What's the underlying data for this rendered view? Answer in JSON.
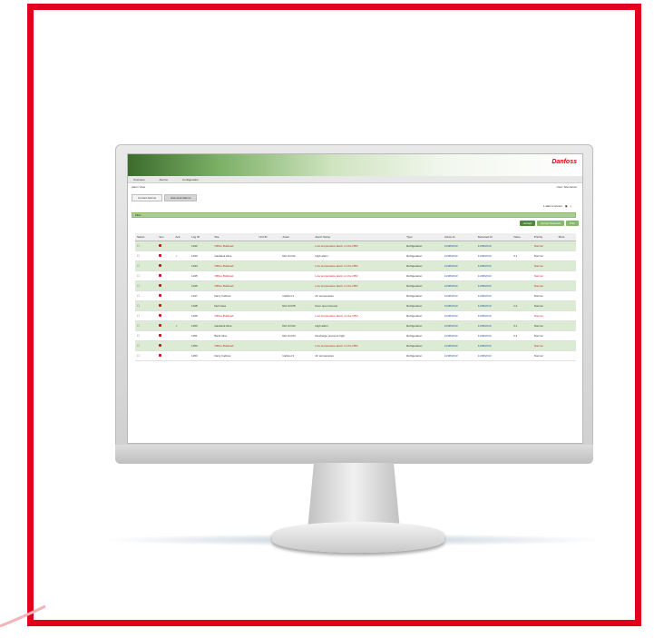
{
  "brand": {
    "name": "Danfoss"
  },
  "colors": {
    "accent": "#e2001a",
    "header_green": "#7bb065",
    "row_alt": "#dcebd3"
  },
  "app": {
    "menu": [
      "Overview",
      "Alarms",
      "Configuration"
    ],
    "breadcrumb": "Alarm View",
    "user_info": "User: Site Admin",
    "tabs": [
      "Current Alarms",
      "Historical Alarms"
    ],
    "view_label": "1 alarms shown",
    "filter_bar": "Filter",
    "actions": [
      "Accept",
      "Accept Selected",
      "Print"
    ],
    "columns": [
      "Select",
      "Sev",
      "Ack",
      "Log ID",
      "Site",
      "Unit ID",
      "Asset",
      "Alarm Name",
      "Type",
      "Active At",
      "Received At",
      "Value",
      "Priority",
      "More"
    ],
    "rows": [
      {
        "log": "1242",
        "site": "Offline Bulkload",
        "unit": "",
        "asset": "",
        "name": "Low temperature alarm on the OBV",
        "type": "Refrigeration",
        "active": "11/08/2013",
        "recv": "11/08/2013",
        "value": "",
        "priority": "Normal",
        "style": "red-alt",
        "ack": ""
      },
      {
        "log": "1243",
        "site": "Gasbank Alive",
        "unit": "",
        "asset": "Ref.Ctrl.02",
        "name": "High alarm",
        "type": "Refrigeration",
        "active": "11/08/2013",
        "recv": "11/08/2013",
        "value": "3.1",
        "priority": "Normal",
        "style": "",
        "ack": "✓"
      },
      {
        "log": "1244",
        "site": "Offline Bulkload",
        "unit": "",
        "asset": "",
        "name": "Low temperature alarm on the OBV",
        "type": "Refrigeration",
        "active": "11/08/2013",
        "recv": "11/08/2013",
        "value": "",
        "priority": "Normal",
        "style": "red-alt",
        "ack": ""
      },
      {
        "log": "1245",
        "site": "Offline Bulkload",
        "unit": "",
        "asset": "",
        "name": "Low temperature alarm on the OBV",
        "type": "Refrigeration",
        "active": "11/08/2013",
        "recv": "11/08/2013",
        "value": "",
        "priority": "Normal",
        "style": "red",
        "ack": ""
      },
      {
        "log": "1246",
        "site": "Offline Bulkload",
        "unit": "",
        "asset": "",
        "name": "Low temperature alarm on the OBV",
        "type": "Refrigeration",
        "active": "11/08/2013",
        "recv": "11/08/2013",
        "value": "",
        "priority": "Normal",
        "style": "red-alt",
        "ack": ""
      },
      {
        "log": "1247",
        "site": "Dairy Cabinet",
        "unit": "",
        "asset": "Cabinet 3",
        "name": "Air temperature",
        "type": "Refrigeration",
        "active": "11/08/2013",
        "recv": "11/08/2013",
        "value": "",
        "priority": "Normal",
        "style": "",
        "ack": ""
      },
      {
        "log": "1248",
        "site": "Deli Case",
        "unit": "",
        "asset": "Ref.Ctrl.05",
        "name": "Door open timeout",
        "type": "Refrigeration",
        "active": "11/08/2013",
        "recv": "11/08/2013",
        "value": "1.2",
        "priority": "Normal",
        "style": "alt",
        "ack": ""
      },
      {
        "log": "1249",
        "site": "Offline Bulkload",
        "unit": "",
        "asset": "",
        "name": "Low temperature alarm on the OBV",
        "type": "Refrigeration",
        "active": "11/08/2013",
        "recv": "11/08/2013",
        "value": "",
        "priority": "Normal",
        "style": "red",
        "ack": ""
      },
      {
        "log": "1250",
        "site": "Gasbank Alive",
        "unit": "",
        "asset": "Ref.Ctrl.02",
        "name": "High alarm",
        "type": "Refrigeration",
        "active": "11/08/2013",
        "recv": "11/08/2013",
        "value": "3.1",
        "priority": "Normal",
        "style": "alt",
        "ack": "✓"
      },
      {
        "log": "1251",
        "site": "Bank Alive",
        "unit": "",
        "asset": "Ref.Ctrl.03",
        "name": "Discharge pressure high",
        "type": "Refrigeration",
        "active": "11/08/2013",
        "recv": "11/08/2013",
        "value": "2.4",
        "priority": "Normal",
        "style": "",
        "ack": ""
      },
      {
        "log": "1252",
        "site": "Offline Bulkload",
        "unit": "",
        "asset": "",
        "name": "Low temperature alarm on the OBV",
        "type": "Refrigeration",
        "active": "11/08/2013",
        "recv": "11/08/2013",
        "value": "",
        "priority": "Normal",
        "style": "red-alt",
        "ack": ""
      },
      {
        "log": "1253",
        "site": "Dairy Cabinet",
        "unit": "",
        "asset": "Cabinet 3",
        "name": "Air temperature",
        "type": "Refrigeration",
        "active": "11/08/2013",
        "recv": "11/08/2013",
        "value": "",
        "priority": "Normal",
        "style": "",
        "ack": ""
      }
    ]
  }
}
